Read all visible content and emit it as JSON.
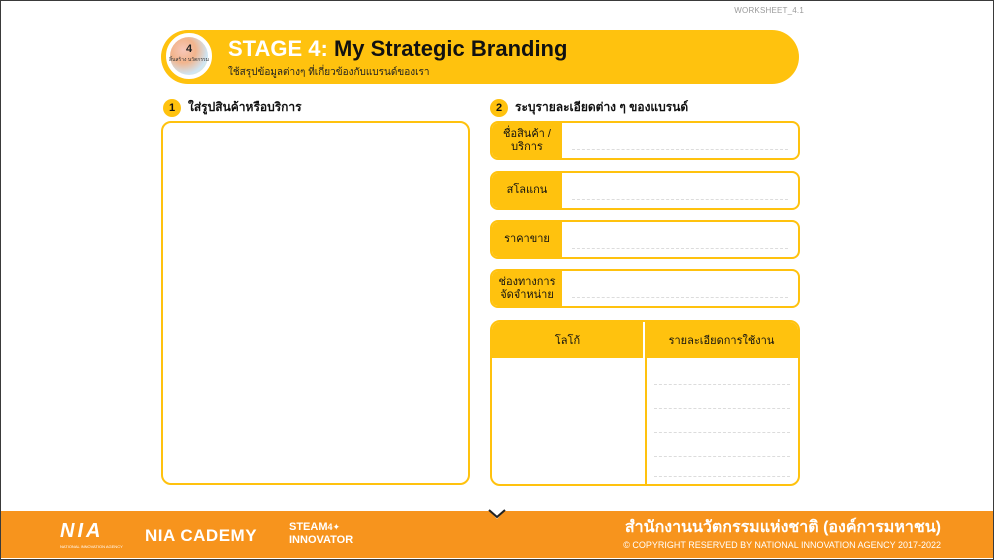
{
  "worksheet_label": "WORKSHEET_4.1",
  "header": {
    "badge_number": "4",
    "badge_text": "สิ้นสร้าง นวัตกรรม",
    "stage_label": "STAGE 4:",
    "title": "My Strategic Branding",
    "subtitle": "ใช้สรุปข้อมูลต่างๆ ที่เกี่ยวข้องกับแบรนด์ของเรา"
  },
  "section1": {
    "number": "1",
    "heading": "ใส่รูปสินค้าหรือบริการ"
  },
  "section2": {
    "number": "2",
    "heading": "ระบุรายละเอียดต่าง ๆ ของแบรนด์",
    "fields": [
      {
        "label": "ชื่อสินค้า /บริการ",
        "value": ""
      },
      {
        "label": "สโลแกน",
        "value": ""
      },
      {
        "label": "ราคาขาย",
        "value": ""
      },
      {
        "label": "ช่องทางการ จัดจำหน่าย",
        "value": ""
      }
    ],
    "table": {
      "col1_header": "โลโก้",
      "col2_header": "รายละเอียดการใช้งาน"
    }
  },
  "footer": {
    "nia_logo": "NIA",
    "nia_logo_sub": "NATIONAL INNOVATION AGENCY",
    "academy_logo": "NIA CADEMY",
    "steam_line1": "STEAM",
    "steam_num": "4",
    "steam_line2": "INNOVATOR",
    "agency_thai": "สำนักงานนวัตกรรมแห่งชาติ (องค์การมหาชน)",
    "copyright": "© COPYRIGHT RESERVED BY NATIONAL INNOVATION AGENCY 2017-2022"
  },
  "colors": {
    "accent_yellow": "#ffc20e",
    "footer_orange": "#f7941d"
  }
}
